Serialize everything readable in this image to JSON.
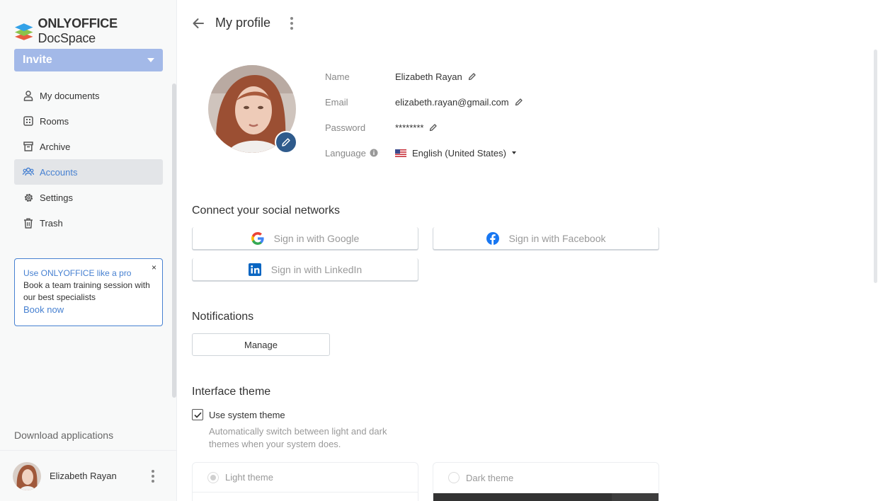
{
  "brand": {
    "name_bold": "ONLYOFFICE",
    "name_rest": " DocSpace"
  },
  "sidebar": {
    "invite_label": "Invite",
    "items": [
      {
        "label": "My documents",
        "icon": "person-icon"
      },
      {
        "label": "Rooms",
        "icon": "rooms-icon"
      },
      {
        "label": "Archive",
        "icon": "archive-icon"
      },
      {
        "label": "Accounts",
        "icon": "accounts-icon",
        "active": true
      },
      {
        "label": "Settings",
        "icon": "gear-icon"
      },
      {
        "label": "Trash",
        "icon": "trash-icon"
      }
    ],
    "promo": {
      "title": "Use ONLYOFFICE like a pro",
      "text": "Book a team training session with our best specialists",
      "link": "Book now",
      "close": "×"
    },
    "download_label": "Download applications",
    "user_name": "Elizabeth Rayan"
  },
  "header": {
    "title": "My profile"
  },
  "profile": {
    "name_label": "Name",
    "name_value": "Elizabeth Rayan",
    "email_label": "Email",
    "email_value": "elizabeth.rayan@gmail.com",
    "password_label": "Password",
    "password_value": "********",
    "language_label": "Language",
    "language_value": "English (United States)"
  },
  "social": {
    "title": "Connect your social networks",
    "google": "Sign in with Google",
    "facebook": "Sign in with Facebook",
    "linkedin": "Sign in with LinkedIn"
  },
  "notifications": {
    "title": "Notifications",
    "manage_label": "Manage"
  },
  "theme": {
    "title": "Interface theme",
    "system_label": "Use system theme",
    "system_desc": "Automatically switch between light and dark themes when your system does.",
    "light_label": "Light theme",
    "dark_label": "Dark theme"
  },
  "colors": {
    "accent": "#4781d1",
    "invite_bg": "#a3b9e8",
    "avatar_edit_bg": "#2f5b8c"
  }
}
